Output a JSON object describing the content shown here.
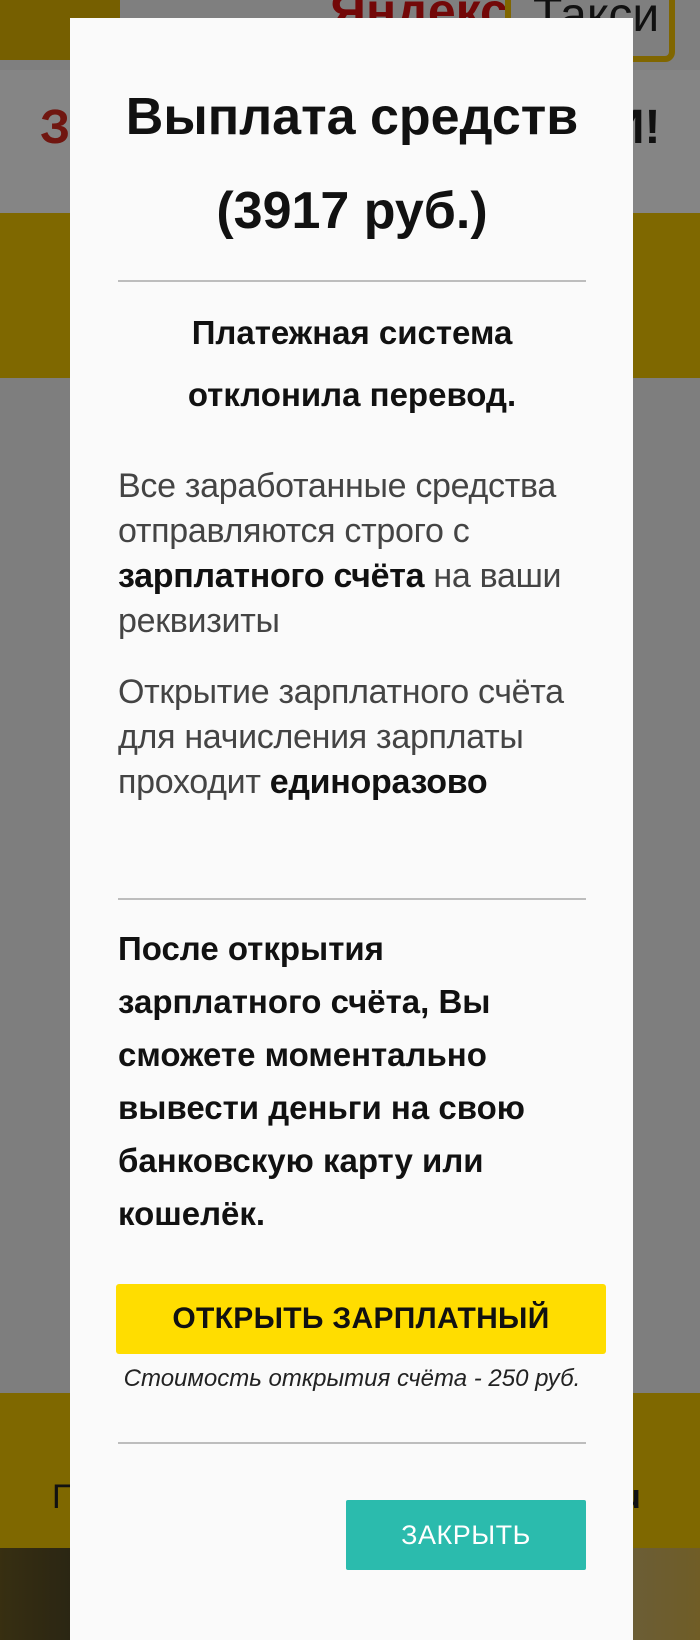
{
  "background": {
    "car_sign": "Яндекс Такси",
    "logo_left": "Яндекс",
    "logo_right": "Такси",
    "promo_left": "З",
    "promo_right": "И!",
    "bottom_left": "П",
    "bottom_right": "u"
  },
  "modal": {
    "title_line1": "Выплата средств",
    "title_line2": "(3917 руб.)",
    "error_line1": "Платежная система",
    "error_line2": "отклонила перевод.",
    "para1_before": "Все заработанные средства отправляются строго с ",
    "para1_bold": "зарплатного счёта",
    "para1_after": " на ваши реквизиты",
    "para2_text": "Открытие зарплатного счёта для начисления зарплаты проходит ",
    "para2_bold": "единоразово",
    "after_open_text": "После открытия зарплатного счёта, Вы сможете моментально вывести деньги на свою банковскую карту или кошелёк.",
    "open_button_label": "ОТКРЫТЬ ЗАРПЛАТНЫЙ",
    "cost_note": "Стоимость открытия счёта - 250 руб.",
    "close_button_label": "ЗАКРЫТЬ"
  },
  "colors": {
    "open_button_bg": "#ffdd00",
    "close_button_bg": "#2bbbad",
    "brand_yellow": "#f4c800"
  }
}
